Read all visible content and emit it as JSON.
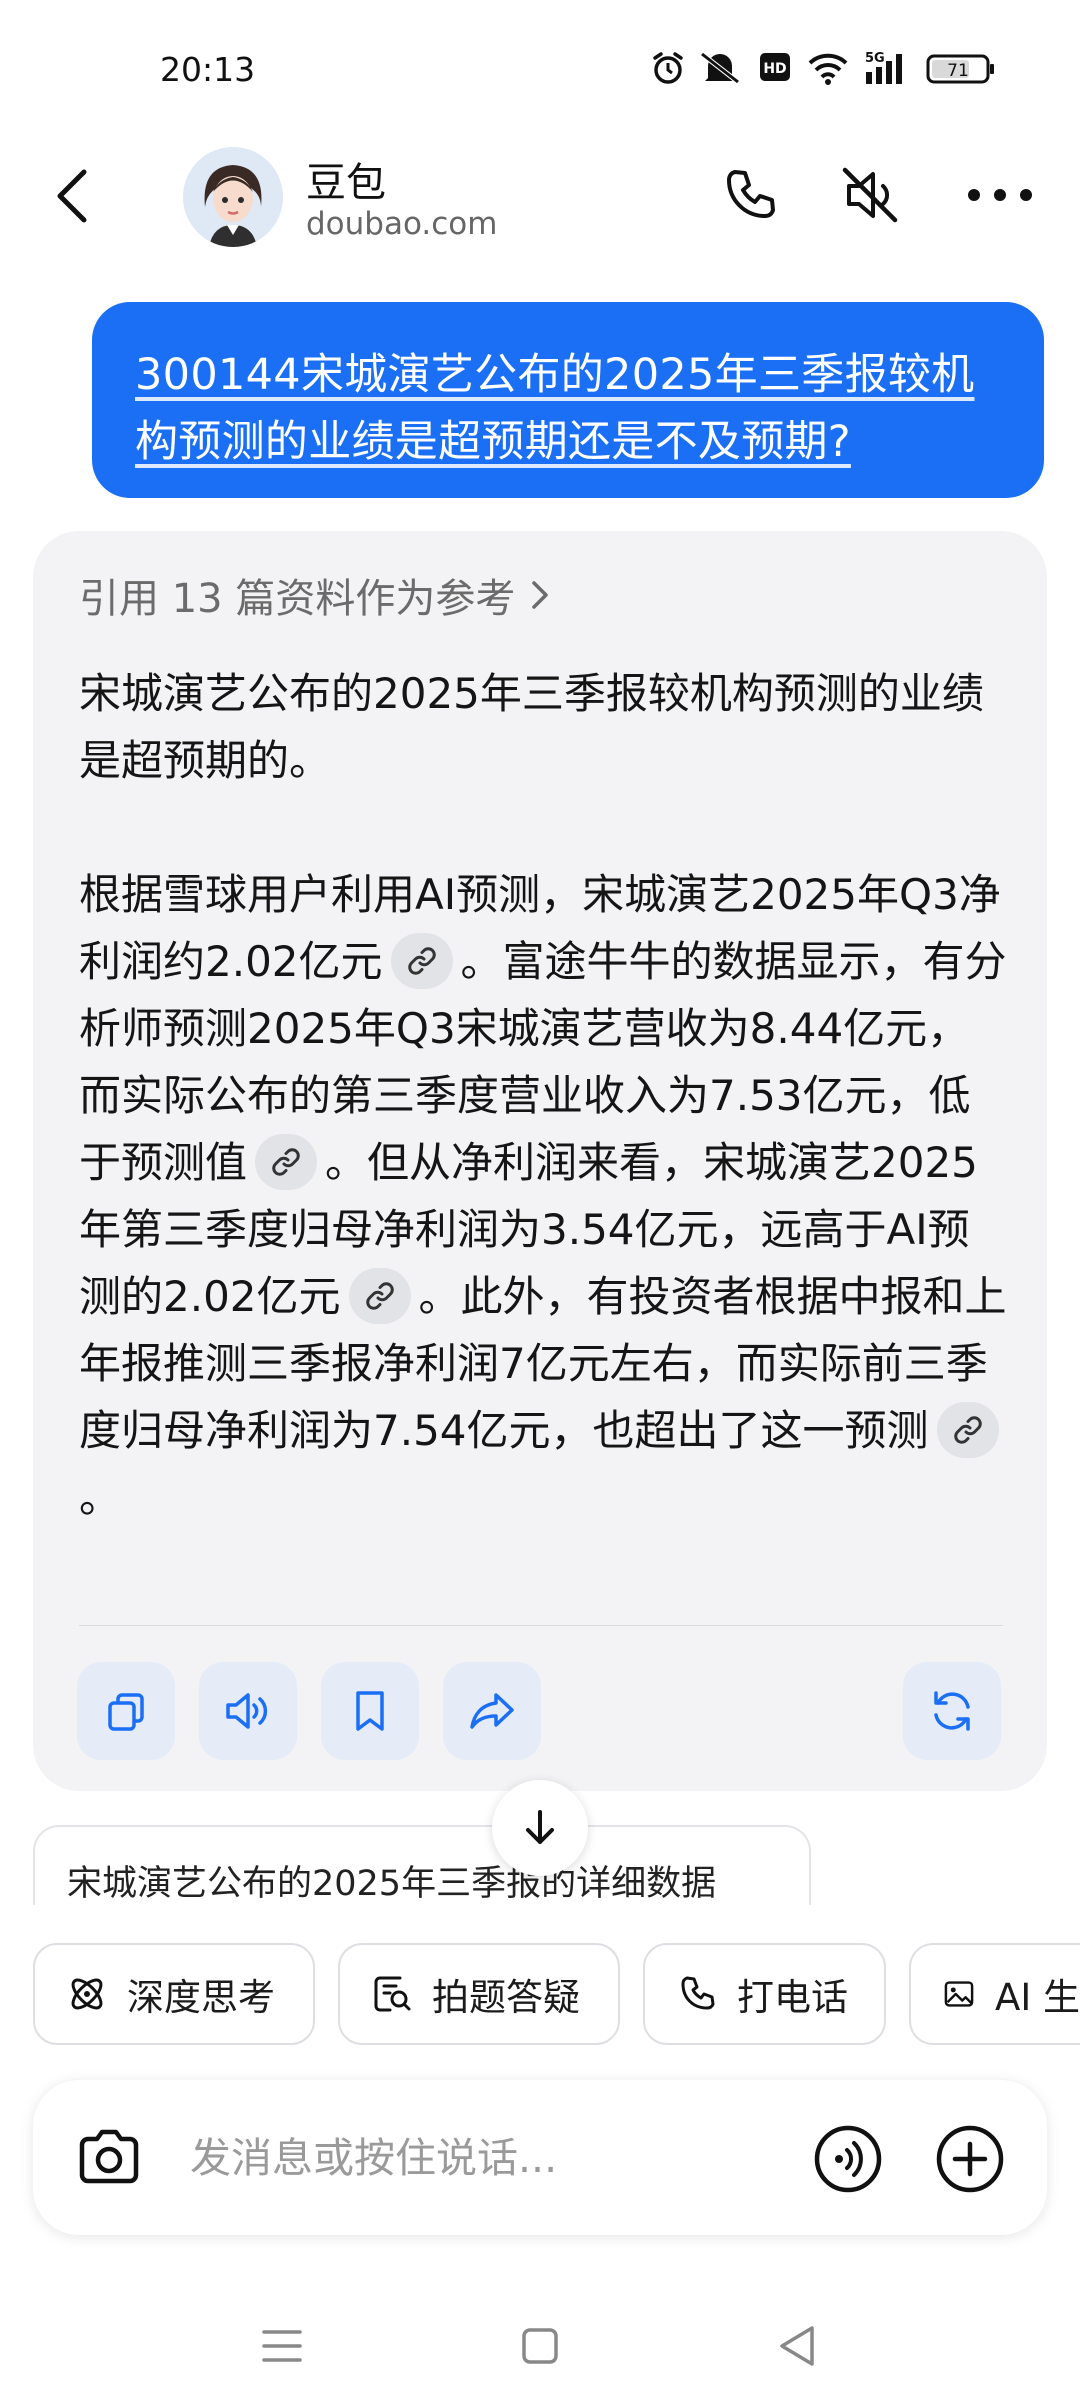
{
  "status_bar": {
    "time": "20:13",
    "battery": "71",
    "network": "5G",
    "icons": [
      "alarm-icon",
      "mute-icon",
      "hd-icon",
      "wifi-icon",
      "signal-icon",
      "battery-icon"
    ]
  },
  "header": {
    "back_icon": "chevron-left-icon",
    "name": "豆包",
    "domain": "doubao.com",
    "actions": [
      "phone-icon",
      "speaker-off-icon",
      "more-icon"
    ]
  },
  "conversation": {
    "user_message": "300144宋城演艺公布的2025年三季报较机构预测的业绩是超预期还是不及预期?",
    "answer": {
      "refs": "引用 13 篇资料作为参考",
      "p1": "宋城演艺公布的2025年三季报较机构预测的业绩是超预期的。",
      "p2_a": "根据雪球用户利用AI预测，宋城演艺2025年Q3净利润约2.02亿元",
      "p2_b": "。富途牛牛的数据显示，有分析师预测2025年Q3宋城演艺营收为8.44亿元，而实际公布的第三季度营业收入为7.53亿元，低于预测值",
      "p2_c": "。但从净利润来看，宋城演艺2025年第三季度归母净利润为3.54亿元，远高于AI预测的2.02亿元",
      "p2_d": "。此外，有投资者根据中报和上年报推测三季报净利润7亿元左右，而实际前三季度归母净利润为7.54亿元，也超出了这一预测",
      "p2_e": "。",
      "actions": [
        "copy-icon",
        "read-aloud-icon",
        "bookmark-icon",
        "share-icon",
        "regenerate-icon"
      ]
    },
    "suggestion": "宋城演艺公布的2025年三季报的详细数据"
  },
  "chips": [
    {
      "icon": "atom-icon",
      "label": "深度思考"
    },
    {
      "icon": "photo-search-icon",
      "label": "拍题答疑"
    },
    {
      "icon": "phone-icon",
      "label": "打电话"
    },
    {
      "icon": "image-icon",
      "label": "AI 生"
    }
  ],
  "input": {
    "placeholder": "发消息或按住说话...",
    "value": ""
  },
  "colors": {
    "accent": "#1b6ff5",
    "card_bg": "#f3f3f5",
    "action_bg": "#e5ecf8"
  }
}
